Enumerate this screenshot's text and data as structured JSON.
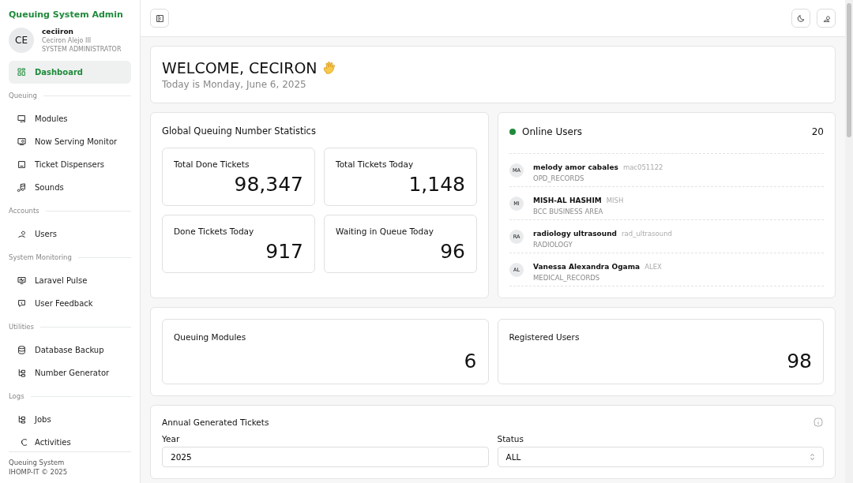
{
  "sidebar": {
    "app_title": "Queuing System Admin",
    "user": {
      "initials": "CE",
      "username": "ceciiron",
      "full_name": "Ceciron Alejo III",
      "role": "SYSTEM ADMINISTRATOR"
    },
    "top_items": [
      {
        "label": "Dashboard",
        "selected": true
      }
    ],
    "sections": [
      {
        "heading": "Queuing",
        "items": [
          {
            "label": "Modules",
            "selected": false
          },
          {
            "label": "Now Serving Monitor",
            "selected": false
          },
          {
            "label": "Ticket Dispensers",
            "selected": false
          },
          {
            "label": "Sounds",
            "selected": false
          }
        ]
      },
      {
        "heading": "Accounts",
        "items": [
          {
            "label": "Users",
            "selected": false
          }
        ]
      },
      {
        "heading": "System Monitoring",
        "items": [
          {
            "label": "Laravel Pulse",
            "selected": false
          },
          {
            "label": "User Feedback",
            "selected": false
          }
        ]
      },
      {
        "heading": "Utilities",
        "items": [
          {
            "label": "Database Backup",
            "selected": false
          },
          {
            "label": "Number Generator",
            "selected": false
          }
        ]
      },
      {
        "heading": "Logs",
        "items": [
          {
            "label": "Jobs",
            "selected": false
          },
          {
            "label": "Activities",
            "selected": false
          }
        ]
      }
    ],
    "footer": [
      "Queuing System",
      "IHOMP-IT © 2025"
    ]
  },
  "welcome": {
    "title": "WELCOME, CECIRON",
    "subtitle": "Today is Monday, June 6, 2025"
  },
  "statistics": {
    "title": "Global Queuing Number Statistics",
    "cards": [
      {
        "label": "Total Done Tickets",
        "value": "98,347"
      },
      {
        "label": "Total Tickets Today",
        "value": "1,148"
      },
      {
        "label": "Done Tickets Today",
        "value": "917"
      },
      {
        "label": "Waiting in Queue Today",
        "value": "96"
      }
    ]
  },
  "online_users": {
    "title": "Online Users",
    "count": "20",
    "users": [
      {
        "initials": "MA",
        "name": "melody amor cabales",
        "username": "mac051122",
        "department": "OPD_RECORDS"
      },
      {
        "initials": "MI",
        "name": "MISH-AL HASHIM",
        "username": "MISH",
        "department": "BCC BUSINESS AREA"
      },
      {
        "initials": "RA",
        "name": "radiology ultrasound",
        "username": "rad_ultrasound",
        "department": "RADIOLOGY"
      },
      {
        "initials": "AL",
        "name": "Vanessa Alexandra Ogama",
        "username": "ALEX",
        "department": "MEDICAL_RECORDS"
      }
    ]
  },
  "totals": [
    {
      "label": "Queuing Modules",
      "value": "6"
    },
    {
      "label": "Registered Users",
      "value": "98"
    }
  ],
  "annual": {
    "title": "Annual Generated Tickets",
    "year_label": "Year",
    "year_value": "2025",
    "status_label": "Status",
    "status_value": "ALL"
  }
}
